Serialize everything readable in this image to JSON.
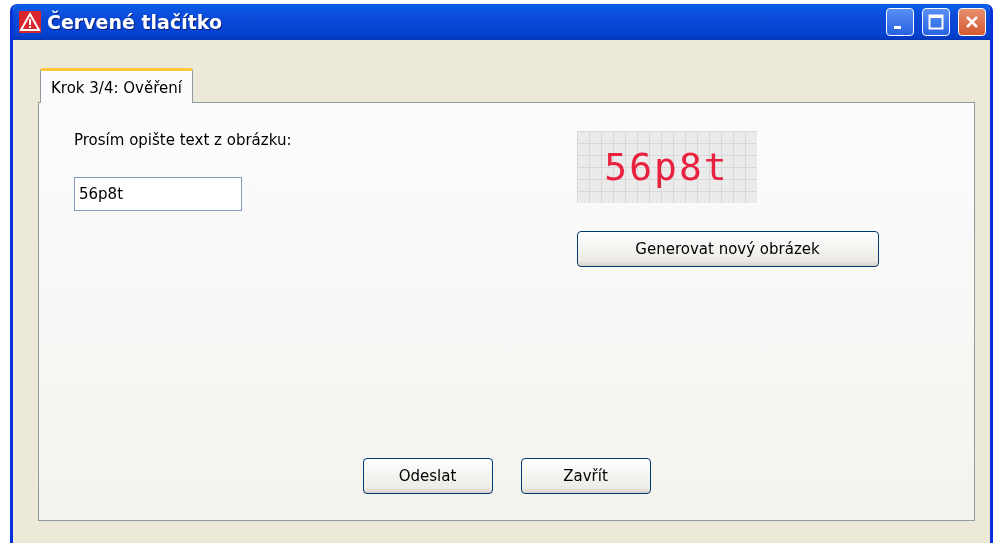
{
  "window": {
    "title": "Červené tlačítko"
  },
  "tabs": [
    {
      "label": "Krok 3/4: Ověření",
      "selected": true
    }
  ],
  "prompt": "Prosím opište text z obrázku:",
  "answer": {
    "value": "56p8t"
  },
  "captcha": {
    "text": "56p8t"
  },
  "regenerate_button": "Generovat nový obrázek",
  "buttons": [
    "Odeslat",
    "Zavřít"
  ]
}
